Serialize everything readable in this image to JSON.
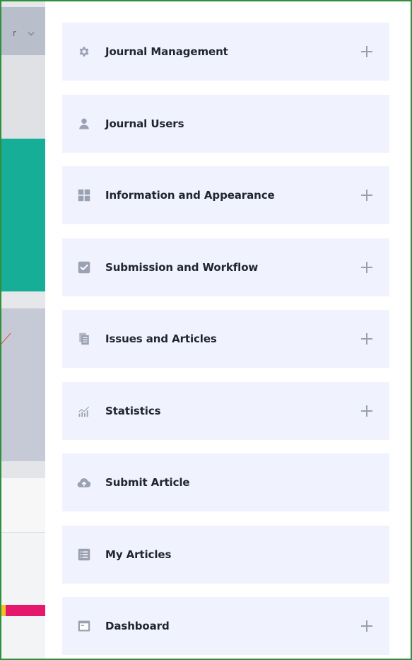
{
  "background": {
    "dropdown_fragment": "r",
    "accent_colors": {
      "teal": "#17ae98",
      "pink": "#e5196b",
      "frame": "#2f8f3a"
    }
  },
  "menu": {
    "items": [
      {
        "label": "Journal Management",
        "icon": "gear-icon",
        "expandable": true
      },
      {
        "label": "Journal Users",
        "icon": "user-icon",
        "expandable": false
      },
      {
        "label": "Information and Appearance",
        "icon": "grid-icon",
        "expandable": true
      },
      {
        "label": "Submission and Workflow",
        "icon": "checkbox-icon",
        "expandable": true
      },
      {
        "label": "Issues and Articles",
        "icon": "documents-icon",
        "expandable": true
      },
      {
        "label": "Statistics",
        "icon": "chart-icon",
        "expandable": true
      },
      {
        "label": "Submit Article",
        "icon": "cloud-upload-icon",
        "expandable": false
      },
      {
        "label": "My Articles",
        "icon": "list-icon",
        "expandable": false
      },
      {
        "label": "Dashboard",
        "icon": "dashboard-icon",
        "expandable": true
      }
    ],
    "item_background": "#f0f3fd",
    "icon_color": "#9aa1b2",
    "text_color": "#202531"
  }
}
